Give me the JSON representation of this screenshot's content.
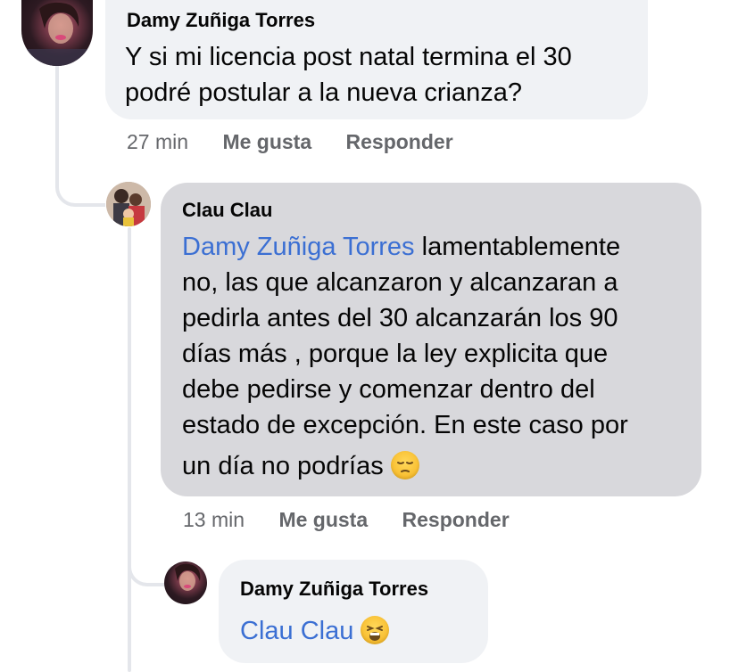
{
  "comments": [
    {
      "author": "Damy Zuñiga Torres",
      "text_line1": "Y si mi licencia post natal termina el 30",
      "text_line2": "podré postular a la nueva crianza?",
      "time": "27 min",
      "like_label": "Me gusta",
      "reply_label": "Responder"
    },
    {
      "author": "Clau Clau",
      "mention": "Damy Zuñiga Torres",
      "text_line1_rest": "lamentablemente",
      "text_line2": "no, las que alcanzaron y alcanzaran a",
      "text_line3": "pedirla antes del 30 alcanzarán los 90",
      "text_line4": "días más , porque la ley explicita que",
      "text_line5": "debe pedirse y comenzar dentro del",
      "text_line6": "estado de excepción. En este caso por",
      "text_line7": "un día no podrías",
      "emoji": "pensive-face",
      "time": "13 min",
      "like_label": "Me gusta",
      "reply_label": "Responder"
    },
    {
      "author": "Damy Zuñiga Torres",
      "mention": "Clau Clau",
      "emoji": "weary-face"
    }
  ],
  "colors": {
    "bubble_light": "#f0f2f5",
    "bubble_highlight": "#d8d8dc",
    "mention": "#3b6fd3",
    "meta": "#65676b",
    "thread_line": "#e4e6eb"
  }
}
